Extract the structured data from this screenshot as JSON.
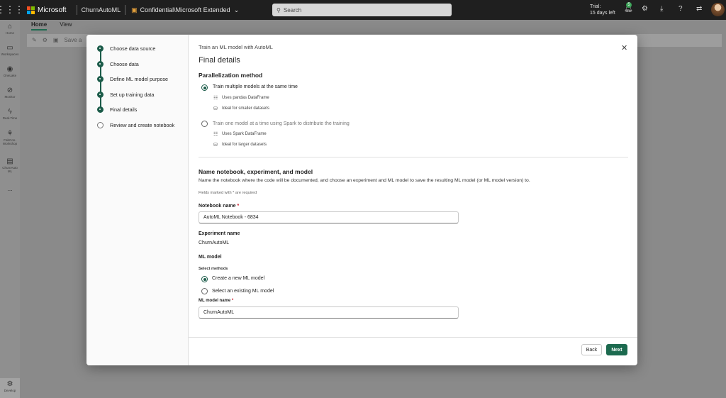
{
  "topbar": {
    "brand": "Microsoft",
    "workspace": "ChurnAutoML",
    "label": "Confidential\\Microsoft Extended",
    "search_placeholder": "Search",
    "trial_line1": "Trial:",
    "trial_line2": "15 days left",
    "notification_count": "5"
  },
  "rail": {
    "items": [
      {
        "label": "Home",
        "icon": "home-icon"
      },
      {
        "label": "Workspaces",
        "icon": "workspaces-icon"
      },
      {
        "label": "OneLake",
        "icon": "onelake-icon"
      },
      {
        "label": "Monitor",
        "icon": "monitor-icon"
      },
      {
        "label": "Real-Time",
        "icon": "realtime-icon"
      },
      {
        "label": "FabCon-Workshop",
        "icon": "workshop-icon"
      },
      {
        "label": "ChurnAuto ML",
        "icon": "notebook-icon"
      }
    ],
    "more": "...",
    "bottom_label": "Develop"
  },
  "ribbon": {
    "tabs": [
      "Home",
      "View"
    ],
    "save_label": "Save a"
  },
  "dialog": {
    "subtitle": "Train an ML model with AutoML",
    "title": "Final details",
    "steps": [
      "Choose data source",
      "Choose data",
      "Define ML model purpose",
      "Set up training data",
      "Final details",
      "Review and create notebook"
    ],
    "parallel": {
      "heading": "Parallelization method",
      "option1": "Train multiple models at the same time",
      "option1_sub1": "Uses pandas DataFrame",
      "option1_sub2": "Ideal for smaller datasets",
      "option2": "Train one model at a time using Spark to distribute the training",
      "option2_sub1": "Uses Spark DataFrame",
      "option2_sub2": "Ideal for larger datasets"
    },
    "naming": {
      "heading": "Name notebook, experiment, and model",
      "description": "Name the notebook where the code will be documented, and choose an experiment and ML model to save the resulting ML model (or ML model version) to.",
      "required_note": "Fields marked with * are required",
      "notebook_label": "Notebook name",
      "notebook_value": "AutoML Notebook - 6834",
      "experiment_label": "Experiment name",
      "experiment_value": "ChurnAutoML",
      "ml_model_heading": "ML model",
      "select_methods": "Select methods",
      "method_new": "Create a new ML model",
      "method_existing": "Select an existing ML model",
      "model_name_label": "ML model name",
      "model_name_value": "ChurnAutoML",
      "required_mark": "*"
    },
    "buttons": {
      "back": "Back",
      "next": "Next"
    }
  },
  "colors": {
    "accent": "#1c6a4f",
    "topbar": "#1f1f1f"
  }
}
